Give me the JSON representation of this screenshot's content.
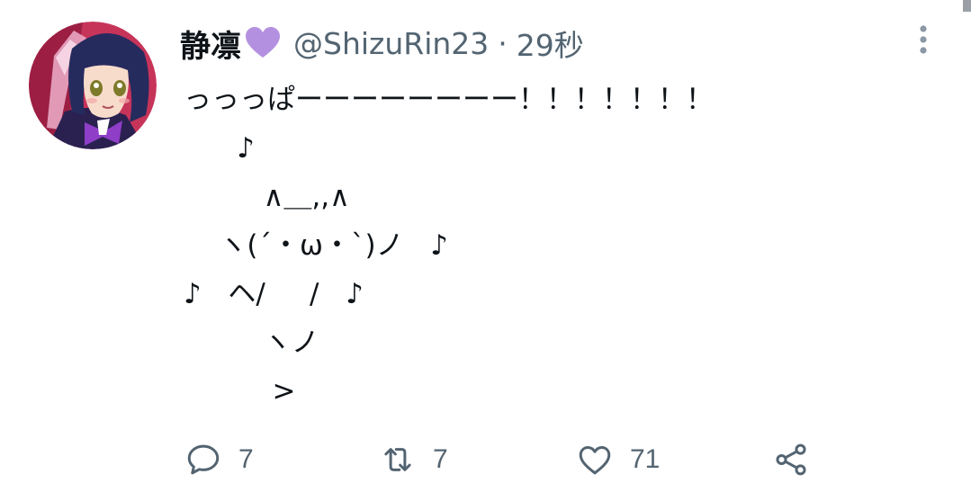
{
  "tweet": {
    "display_name": "静凛",
    "handle": "@ShizuRin23",
    "separator": "·",
    "time": "29秒",
    "text_lines": [
      "っっっぱーーーーーーーー！！！！！！！",
      "      ♪",
      "         ∧＿,,∧",
      "    ヽ(´・ω・`)ノ   ♪",
      "♪   ヘ/     /   ♪",
      "         ヽノ",
      "          >"
    ]
  },
  "actions": {
    "reply_count": "7",
    "retweet_count": "7",
    "like_count": "71"
  },
  "colors": {
    "text": "#0f1419",
    "secondary": "#536471",
    "heart_emoji": "#b491e0"
  },
  "icons": {
    "name_emoji": "purple-heart-icon",
    "more": "more-vertical-icon",
    "reply": "reply-icon",
    "retweet": "retweet-icon",
    "like": "like-icon",
    "share": "share-icon"
  }
}
